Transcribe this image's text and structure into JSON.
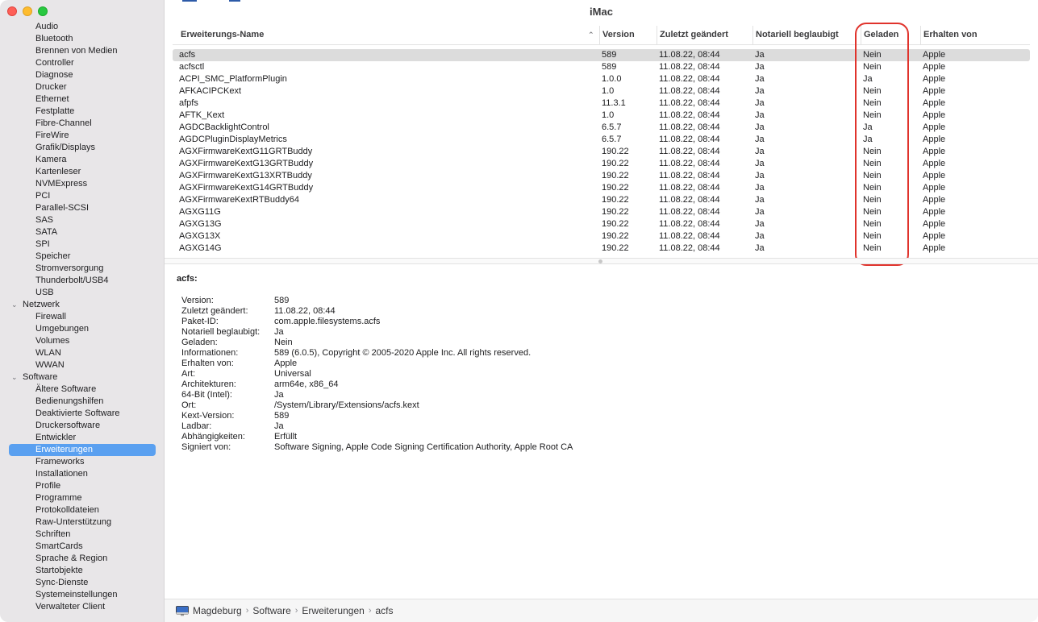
{
  "window": {
    "title": "iMac"
  },
  "sidebar": {
    "items": [
      {
        "label": "Audio",
        "type": "item"
      },
      {
        "label": "Bluetooth",
        "type": "item"
      },
      {
        "label": "Brennen von Medien",
        "type": "item"
      },
      {
        "label": "Controller",
        "type": "item"
      },
      {
        "label": "Diagnose",
        "type": "item"
      },
      {
        "label": "Drucker",
        "type": "item"
      },
      {
        "label": "Ethernet",
        "type": "item"
      },
      {
        "label": "Festplatte",
        "type": "item"
      },
      {
        "label": "Fibre-Channel",
        "type": "item"
      },
      {
        "label": "FireWire",
        "type": "item"
      },
      {
        "label": "Grafik/Displays",
        "type": "item"
      },
      {
        "label": "Kamera",
        "type": "item"
      },
      {
        "label": "Kartenleser",
        "type": "item"
      },
      {
        "label": "NVMExpress",
        "type": "item"
      },
      {
        "label": "PCI",
        "type": "item"
      },
      {
        "label": "Parallel-SCSI",
        "type": "item"
      },
      {
        "label": "SAS",
        "type": "item"
      },
      {
        "label": "SATA",
        "type": "item"
      },
      {
        "label": "SPI",
        "type": "item"
      },
      {
        "label": "Speicher",
        "type": "item"
      },
      {
        "label": "Stromversorgung",
        "type": "item"
      },
      {
        "label": "Thunderbolt/USB4",
        "type": "item"
      },
      {
        "label": "USB",
        "type": "item"
      },
      {
        "label": "Netzwerk",
        "type": "group"
      },
      {
        "label": "Firewall",
        "type": "item"
      },
      {
        "label": "Umgebungen",
        "type": "item"
      },
      {
        "label": "Volumes",
        "type": "item"
      },
      {
        "label": "WLAN",
        "type": "item"
      },
      {
        "label": "WWAN",
        "type": "item"
      },
      {
        "label": "Software",
        "type": "group"
      },
      {
        "label": "Ältere Software",
        "type": "item"
      },
      {
        "label": "Bedienungshilfen",
        "type": "item"
      },
      {
        "label": "Deaktivierte Software",
        "type": "item"
      },
      {
        "label": "Druckersoftware",
        "type": "item"
      },
      {
        "label": "Entwickler",
        "type": "item"
      },
      {
        "label": "Erweiterungen",
        "type": "item",
        "selected": true
      },
      {
        "label": "Frameworks",
        "type": "item"
      },
      {
        "label": "Installationen",
        "type": "item"
      },
      {
        "label": "Profile",
        "type": "item"
      },
      {
        "label": "Programme",
        "type": "item"
      },
      {
        "label": "Protokolldateien",
        "type": "item"
      },
      {
        "label": "Raw-Unterstützung",
        "type": "item"
      },
      {
        "label": "Schriften",
        "type": "item"
      },
      {
        "label": "SmartCards",
        "type": "item"
      },
      {
        "label": "Sprache & Region",
        "type": "item"
      },
      {
        "label": "Startobjekte",
        "type": "item"
      },
      {
        "label": "Sync-Dienste",
        "type": "item"
      },
      {
        "label": "Systemeinstellungen",
        "type": "item"
      },
      {
        "label": "Verwalteter Client",
        "type": "item"
      }
    ]
  },
  "table": {
    "columns": [
      "Erweiterungs-Name",
      "Version",
      "Zuletzt geändert",
      "Notariell beglaubigt",
      "Geladen",
      "Erhalten von"
    ],
    "rows": [
      [
        "acfs",
        "589",
        "11.08.22, 08:44",
        "Ja",
        "Nein",
        "Apple"
      ],
      [
        "acfsctl",
        "589",
        "11.08.22, 08:44",
        "Ja",
        "Nein",
        "Apple"
      ],
      [
        "ACPI_SMC_PlatformPlugin",
        "1.0.0",
        "11.08.22, 08:44",
        "Ja",
        "Ja",
        "Apple"
      ],
      [
        "AFKACIPCKext",
        "1.0",
        "11.08.22, 08:44",
        "Ja",
        "Nein",
        "Apple"
      ],
      [
        "afpfs",
        "11.3.1",
        "11.08.22, 08:44",
        "Ja",
        "Nein",
        "Apple"
      ],
      [
        "AFTK_Kext",
        "1.0",
        "11.08.22, 08:44",
        "Ja",
        "Nein",
        "Apple"
      ],
      [
        "AGDCBacklightControl",
        "6.5.7",
        "11.08.22, 08:44",
        "Ja",
        "Ja",
        "Apple"
      ],
      [
        "AGDCPluginDisplayMetrics",
        "6.5.7",
        "11.08.22, 08:44",
        "Ja",
        "Ja",
        "Apple"
      ],
      [
        "AGXFirmwareKextG11GRTBuddy",
        "190.22",
        "11.08.22, 08:44",
        "Ja",
        "Nein",
        "Apple"
      ],
      [
        "AGXFirmwareKextG13GRTBuddy",
        "190.22",
        "11.08.22, 08:44",
        "Ja",
        "Nein",
        "Apple"
      ],
      [
        "AGXFirmwareKextG13XRTBuddy",
        "190.22",
        "11.08.22, 08:44",
        "Ja",
        "Nein",
        "Apple"
      ],
      [
        "AGXFirmwareKextG14GRTBuddy",
        "190.22",
        "11.08.22, 08:44",
        "Ja",
        "Nein",
        "Apple"
      ],
      [
        "AGXFirmwareKextRTBuddy64",
        "190.22",
        "11.08.22, 08:44",
        "Ja",
        "Nein",
        "Apple"
      ],
      [
        "AGXG11G",
        "190.22",
        "11.08.22, 08:44",
        "Ja",
        "Nein",
        "Apple"
      ],
      [
        "AGXG13G",
        "190.22",
        "11.08.22, 08:44",
        "Ja",
        "Nein",
        "Apple"
      ],
      [
        "AGXG13X",
        "190.22",
        "11.08.22, 08:44",
        "Ja",
        "Nein",
        "Apple"
      ],
      [
        "AGXG14G",
        "190.22",
        "11.08.22, 08:44",
        "Ja",
        "Nein",
        "Apple"
      ]
    ]
  },
  "detail": {
    "title": "acfs:",
    "fields": [
      [
        "Version:",
        "589"
      ],
      [
        "Zuletzt geändert:",
        "11.08.22, 08:44"
      ],
      [
        "Paket-ID:",
        "com.apple.filesystems.acfs"
      ],
      [
        "Notariell beglaubigt:",
        "Ja"
      ],
      [
        "Geladen:",
        "Nein"
      ],
      [
        "Informationen:",
        "589 (6.0.5), Copyright © 2005-2020 Apple Inc. All rights reserved."
      ],
      [
        "Erhalten von:",
        "Apple"
      ],
      [
        "Art:",
        "Universal"
      ],
      [
        "Architekturen:",
        "arm64e, x86_64"
      ],
      [
        "64-Bit (Intel):",
        "Ja"
      ],
      [
        "Ort:",
        "/System/Library/Extensions/acfs.kext"
      ],
      [
        "Kext-Version:",
        "589"
      ],
      [
        "Ladbar:",
        "Ja"
      ],
      [
        "Abhängigkeiten:",
        "Erfüllt"
      ],
      [
        "Signiert von:",
        "Software Signing, Apple Code Signing Certification Authority, Apple Root CA"
      ]
    ]
  },
  "pathbar": {
    "crumbs": [
      "Magdeburg",
      "Software",
      "Erweiterungen",
      "acfs"
    ]
  },
  "colors": {
    "accent": "#5aa0f0",
    "highlight": "#e0332c"
  }
}
